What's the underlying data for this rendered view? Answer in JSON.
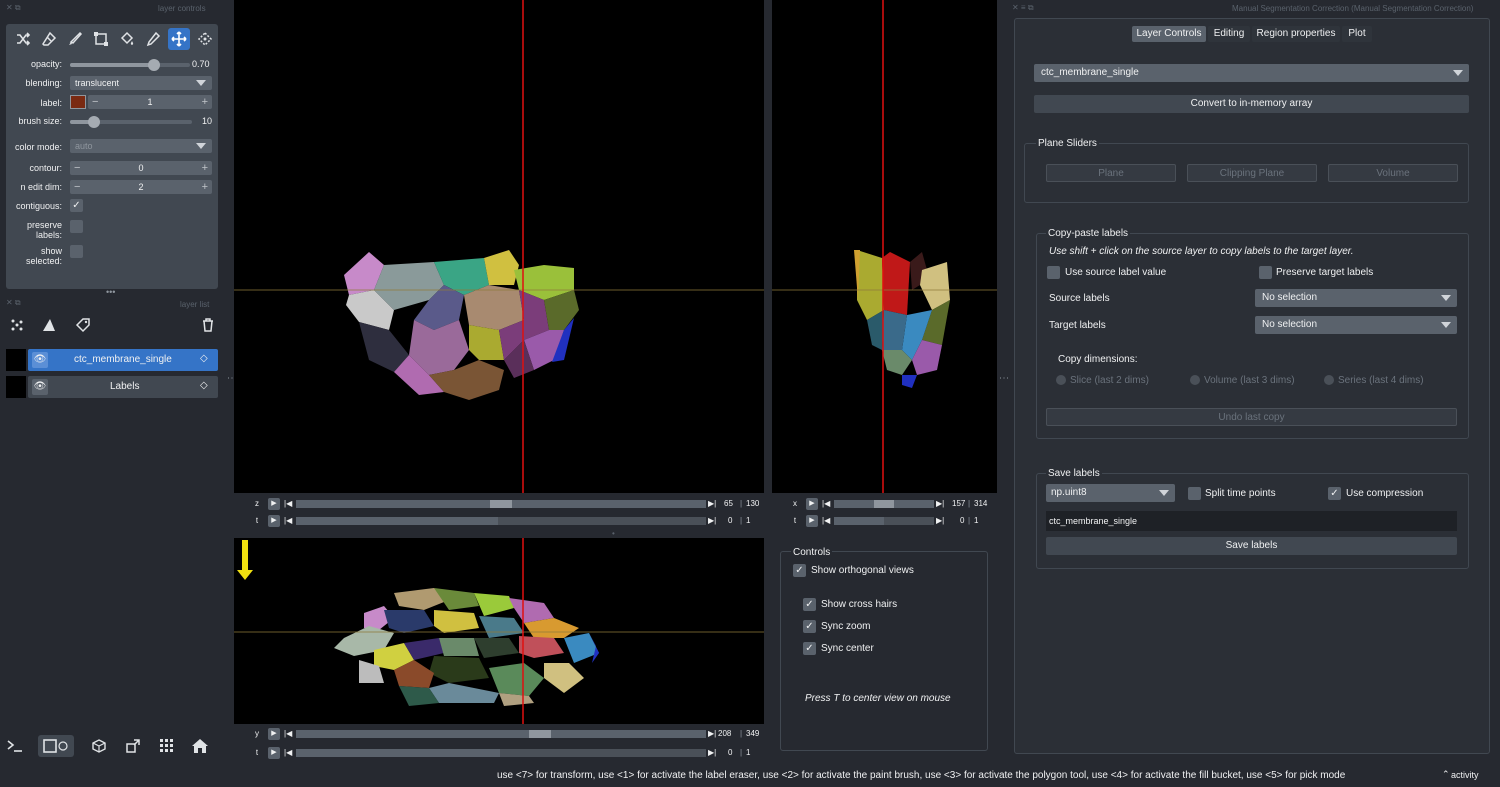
{
  "left_dock": {
    "title": "layer controls",
    "opacity_label": "opacity:",
    "opacity_value": "0.70",
    "opacity_fraction": 0.7,
    "blending_label": "blending:",
    "blending_value": "translucent",
    "label_label": "label:",
    "label_value": "1",
    "label_color": "#7a2a12",
    "brush_label": "brush size:",
    "brush_value": "10",
    "brush_fraction": 0.2,
    "color_mode_label": "color mode:",
    "color_mode_value": "auto",
    "contour_label": "contour:",
    "contour_value": "0",
    "ndim_label": "n edit dim:",
    "ndim_value": "2",
    "contiguous_label": "contiguous:",
    "preserve_label_1": "preserve",
    "preserve_label_2": "labels:",
    "show_label_1": "show",
    "show_label_2": "selected:",
    "accent": "#3574c7"
  },
  "layer_list": {
    "title": "layer list",
    "layers": [
      {
        "name": "ctc_membrane_single",
        "selected": true
      },
      {
        "name": "Labels",
        "selected": false
      }
    ]
  },
  "dims": {
    "main_z": {
      "axis": "z",
      "value": "65",
      "max": "130",
      "pos": 0.5
    },
    "main_t": {
      "axis": "t",
      "value": "0",
      "max": "1",
      "pos": 0.0
    },
    "right_x": {
      "axis": "x",
      "value": "157",
      "max": "314",
      "pos": 0.5
    },
    "right_t": {
      "axis": "t",
      "value": "0",
      "max": "1",
      "pos": 0.0
    },
    "bottom_y": {
      "axis": "y",
      "value": "208",
      "max": "349",
      "pos": 0.6
    },
    "bottom_t": {
      "axis": "t",
      "value": "0",
      "max": "1",
      "pos": 0.0
    }
  },
  "controls": {
    "title": "Controls",
    "show_ortho": "Show orthogonal views",
    "cross_hairs": "Show cross hairs",
    "sync_zoom": "Sync zoom",
    "sync_center": "Sync center",
    "hint": "Press T to center view on mouse"
  },
  "right_dock": {
    "title": "Manual Segmentation Correction (Manual Segmentation Correction)",
    "tabs": [
      "Layer Controls",
      "Editing",
      "Region properties",
      "Plot"
    ],
    "layer_select": "ctc_membrane_single",
    "convert_button": "Convert to in-memory array",
    "plane_sliders_title": "Plane Sliders",
    "plane_buttons": [
      "Plane",
      "Clipping Plane",
      "Volume"
    ],
    "copy_title": "Copy-paste labels",
    "copy_hint": "Use shift + click on the source layer to copy labels to the target layer.",
    "use_source": "Use source label value",
    "preserve_target": "Preserve target labels",
    "source_labels": "Source labels",
    "target_labels": "Target labels",
    "no_selection": "No selection",
    "copy_dims": "Copy dimensions:",
    "dim_options": [
      "Slice (last 2 dims)",
      "Volume (last 3 dims)",
      "Series (last 4 dims)"
    ],
    "undo": "Undo last copy",
    "save_title": "Save labels",
    "dtype": "np.uint8",
    "split_time": "Split time points",
    "use_compression": "Use compression",
    "filename": "ctc_membrane_single",
    "save_button": "Save labels"
  },
  "status": {
    "text": "use <7> for transform, use <1> for activate the label eraser, use <2> for activate the paint brush, use <3> for activate the polygon tool, use <4> for activate the fill bucket, use <5> for pick mode",
    "activity": "activity"
  },
  "icons": [
    "shuffle-icon",
    "eraser-icon",
    "brush-icon",
    "polygon-icon",
    "fill-bucket-icon",
    "picker-icon",
    "pan-zoom-icon",
    "transform-icon",
    "points-icon",
    "shapes-icon",
    "labels-icon",
    "trash-icon",
    "console-icon",
    "ndisplay-icon",
    "roll-icon",
    "transpose-icon",
    "grid-icon",
    "home-icon"
  ]
}
